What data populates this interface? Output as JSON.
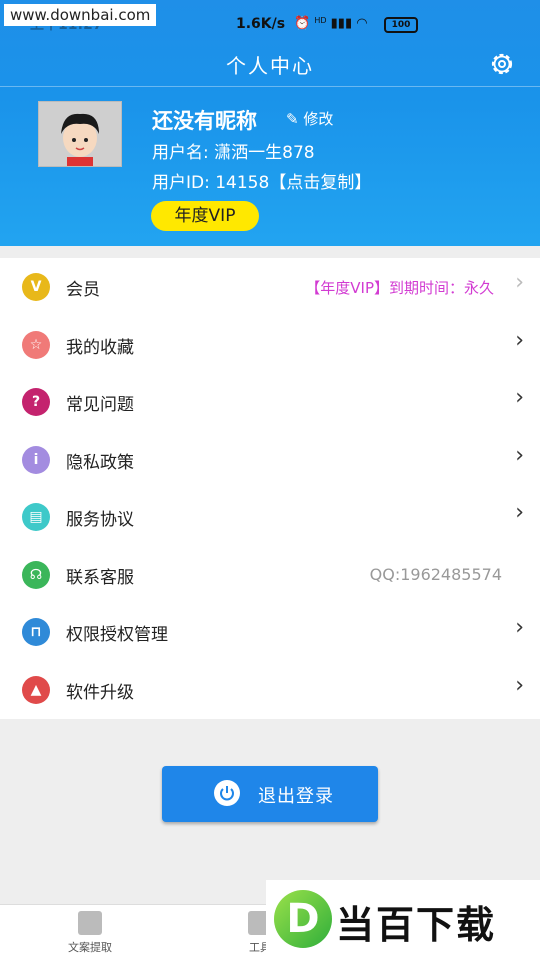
{
  "status": {
    "watermark": "www.downbai.com",
    "speed": "1.6K/s",
    "signal": "HD",
    "battery": "100"
  },
  "header": {
    "title": "个人中心",
    "nickname": "还没有昵称",
    "edit_label": "修改",
    "username_line": "用户名: 潇洒一生878",
    "userid_line": "用户ID: 14158【点击复制】",
    "vip_badge": "年度VIP"
  },
  "menu": [
    {
      "label": "会员",
      "icon": "vip-icon",
      "color": "#e8b81a",
      "extra": "【年度VIP】到期时间：永久"
    },
    {
      "label": "我的收藏",
      "icon": "star-icon",
      "color": "#f07a78"
    },
    {
      "label": "常见问题",
      "icon": "question-icon",
      "color": "#c4236e"
    },
    {
      "label": "隐私政策",
      "icon": "info-icon",
      "color": "#a38ce0"
    },
    {
      "label": "服务协议",
      "icon": "document-icon",
      "color": "#3ec9c9"
    },
    {
      "label": "联系客服",
      "icon": "headset-icon",
      "color": "#3bb65a",
      "extra": "QQ:1962485574"
    },
    {
      "label": "权限授权管理",
      "icon": "lock-icon",
      "color": "#2f8ad8"
    },
    {
      "label": "软件升级",
      "icon": "rocket-icon",
      "color": "#e04a4a"
    }
  ],
  "logout": {
    "label": "退出登录"
  },
  "tabs": [
    {
      "label": "文案提取"
    },
    {
      "label": "工具"
    }
  ],
  "watermark_bottom": {
    "logo": "D",
    "text": "当百下载"
  },
  "colors": {
    "primary": "#1a93ea",
    "vip_text": "#d23bd2",
    "badge": "#ffe800"
  }
}
